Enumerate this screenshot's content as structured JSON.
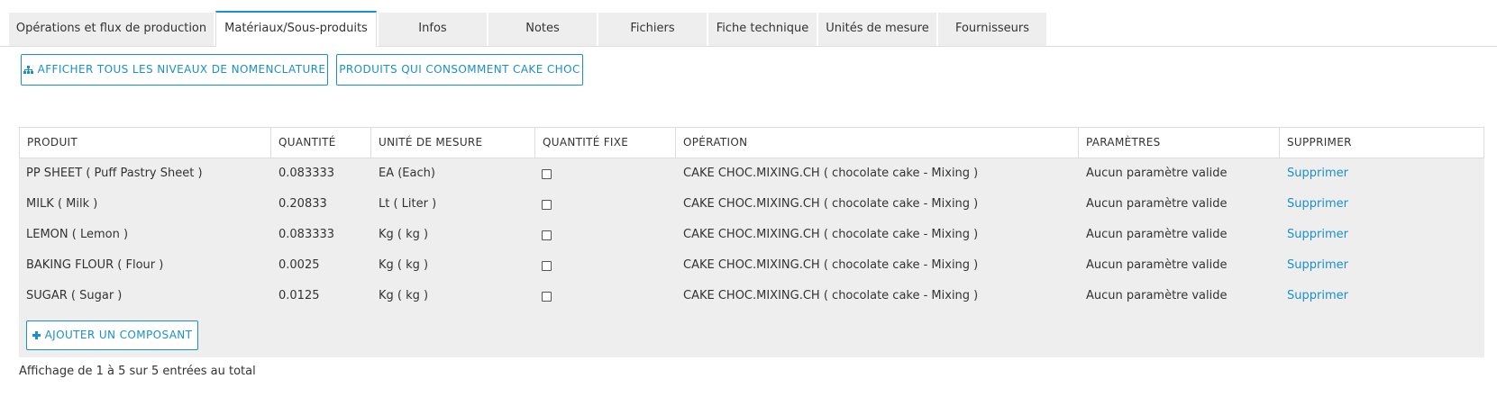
{
  "tabs": [
    {
      "label": "Opérations et flux de production"
    },
    {
      "label": "Matériaux/Sous-produits"
    },
    {
      "label": "Infos"
    },
    {
      "label": "Notes"
    },
    {
      "label": "Fichiers"
    },
    {
      "label": "Fiche technique"
    },
    {
      "label": "Unités de mesure"
    },
    {
      "label": "Fournisseurs"
    }
  ],
  "active_tab": "Matériaux/Sous-produits",
  "toolbar": {
    "show_bom_label": "AFFICHER TOUS LES NIVEAUX DE NOMENCLATURE",
    "show_bom_icon": "sitemap-icon",
    "consumers_label": "PRODUITS QUI CONSOMMENT CAKE CHOC"
  },
  "table": {
    "headers": [
      "PRODUIT",
      "QUANTITÉ",
      "UNITÉ DE MESURE",
      "QUANTITÉ FIXE",
      "OPÉRATION",
      "PARAMÈTRES",
      "SUPPRIMER"
    ],
    "rows": [
      {
        "produit": "PP SHEET ( Puff Pastry Sheet )",
        "quantite": "0.083333",
        "unite": "EA (Each)",
        "fixe": false,
        "operation": "CAKE CHOC.MIXING.CH ( chocolate cake - Mixing )",
        "parametres": "Aucun paramètre valide",
        "supprimer": "Supprimer"
      },
      {
        "produit": "MILK ( Milk )",
        "quantite": "0.20833",
        "unite": "Lt ( Liter )",
        "fixe": false,
        "operation": "CAKE CHOC.MIXING.CH ( chocolate cake - Mixing )",
        "parametres": "Aucun paramètre valide",
        "supprimer": "Supprimer"
      },
      {
        "produit": "LEMON ( Lemon )",
        "quantite": "0.083333",
        "unite": "Kg ( kg )",
        "fixe": false,
        "operation": "CAKE CHOC.MIXING.CH ( chocolate cake - Mixing )",
        "parametres": "Aucun paramètre valide",
        "supprimer": "Supprimer"
      },
      {
        "produit": "BAKING FLOUR ( Flour )",
        "quantite": "0.0025",
        "unite": "Kg ( kg )",
        "fixe": false,
        "operation": "CAKE CHOC.MIXING.CH ( chocolate cake - Mixing )",
        "parametres": "Aucun paramètre valide",
        "supprimer": "Supprimer"
      },
      {
        "produit": "SUGAR ( Sugar )",
        "quantite": "0.0125",
        "unite": "Kg ( kg )",
        "fixe": false,
        "operation": "CAKE CHOC.MIXING.CH ( chocolate cake - Mixing )",
        "parametres": "Aucun paramètre valide",
        "supprimer": "Supprimer"
      }
    ],
    "add_label": "AJOUTER UN COMPOSANT",
    "add_icon": "plus-icon"
  },
  "footer": {
    "summary": "Affichage de 1 à 5 sur 5 entrées au total"
  },
  "colors": {
    "accent": "#1a90c9",
    "row_background": "#eeeeee",
    "tab_background": "#eeeeee"
  }
}
